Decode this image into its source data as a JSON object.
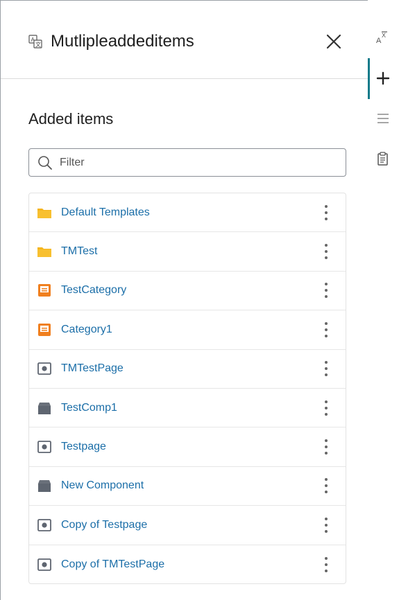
{
  "panel": {
    "title": "Mutlipleaddeditems",
    "section_title": "Added items",
    "filter": {
      "placeholder": "Filter",
      "value": ""
    }
  },
  "items": [
    {
      "label": "Default Templates",
      "icon": "folder-icon"
    },
    {
      "label": "TMTest",
      "icon": "folder-icon"
    },
    {
      "label": "TestCategory",
      "icon": "category-icon"
    },
    {
      "label": "Category1",
      "icon": "category-icon"
    },
    {
      "label": "TMTestPage",
      "icon": "page-icon"
    },
    {
      "label": "TestComp1",
      "icon": "component-icon"
    },
    {
      "label": "Testpage",
      "icon": "page-icon"
    },
    {
      "label": "New Component",
      "icon": "component-icon"
    },
    {
      "label": "Copy of Testpage",
      "icon": "page-icon"
    },
    {
      "label": "Copy of TMTestPage",
      "icon": "page-icon"
    }
  ],
  "rail": [
    {
      "icon": "translate-icon"
    },
    {
      "icon": "plus-icon",
      "active": true
    },
    {
      "icon": "menu-icon"
    },
    {
      "icon": "clipboard-icon"
    }
  ],
  "colors": {
    "link": "#1b6ea8",
    "folder": "#f5b51f",
    "category": "#f07f1e",
    "accent": "#137a8a"
  }
}
